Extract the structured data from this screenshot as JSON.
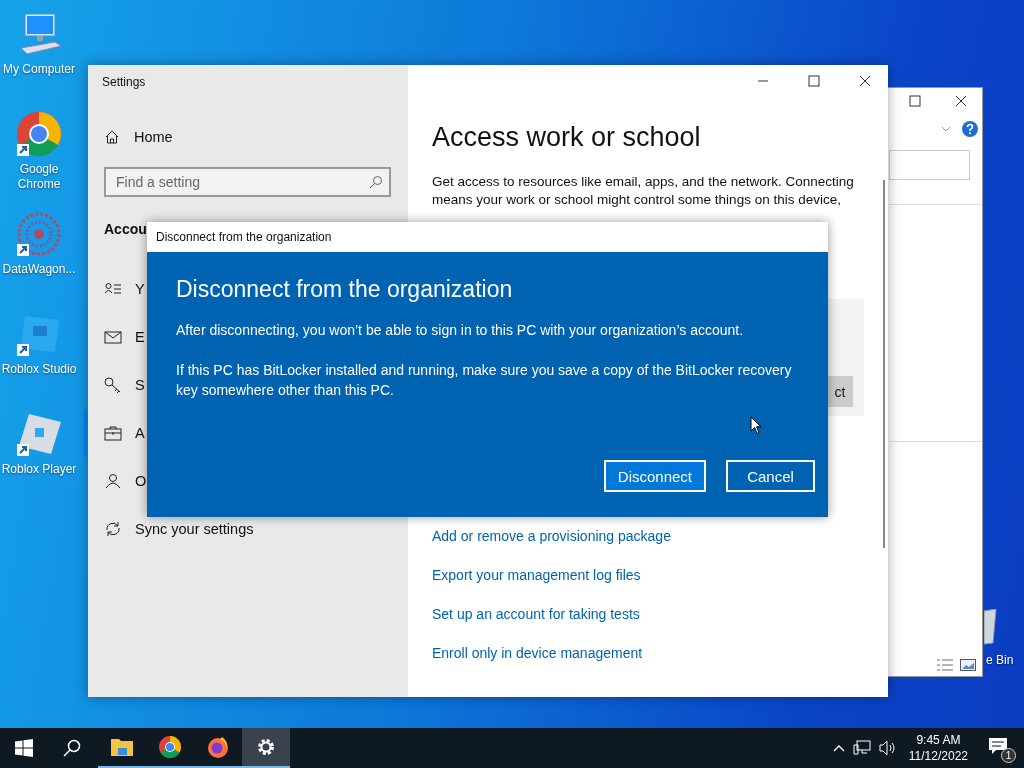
{
  "desktop": {
    "icons": [
      {
        "label": "My Computer",
        "kind": "computer"
      },
      {
        "label": "Google Chrome",
        "kind": "chrome"
      },
      {
        "label": "DataWagon...",
        "kind": "mandala"
      },
      {
        "label": "Roblox Studio",
        "kind": "studio"
      },
      {
        "label": "Roblox Player",
        "kind": "player"
      }
    ],
    "partial_label": "e Bin"
  },
  "settings_window": {
    "title": "Settings",
    "sidebar": {
      "home": "Home",
      "search": {
        "placeholder": "Find a setting"
      },
      "heading": "Accou",
      "items": [
        {
          "label": "Y",
          "kind": "user-info",
          "selected": false
        },
        {
          "label": "E",
          "kind": "mail",
          "selected": false
        },
        {
          "label": "S",
          "kind": "key",
          "selected": false
        },
        {
          "label": "A",
          "kind": "briefcase",
          "selected": true
        },
        {
          "label": "O",
          "kind": "person",
          "selected": false
        },
        {
          "label": "Sync your settings",
          "kind": "sync",
          "selected": false
        }
      ]
    },
    "content": {
      "heading": "Access work or school",
      "description": "Get access to resources like email, apps, and the network. Connecting means your work or school might control some things on this device,",
      "card_button": "ct",
      "links": [
        "Add or remove a provisioning package",
        "Export your management log files",
        "Set up an account for taking tests",
        "Enroll only in device management"
      ]
    }
  },
  "dialog": {
    "title": "Disconnect from the organization",
    "heading": "Disconnect from the organization",
    "paragraphs": [
      "After disconnecting, you won’t be able to sign in to this PC with your organization’s account.",
      "If this PC has BitLocker installed and running, make sure you save a copy of the BitLocker recovery key somewhere other than this PC."
    ],
    "buttons": [
      {
        "label": "Disconnect",
        "focused": true
      },
      {
        "label": "Cancel",
        "focused": false
      }
    ]
  },
  "taskbar": {
    "apps": [
      {
        "kind": "explorer",
        "running": true,
        "active": false
      },
      {
        "kind": "chrome",
        "running": true,
        "active": false
      },
      {
        "kind": "firefox",
        "running": true,
        "active": false
      },
      {
        "kind": "settings",
        "running": true,
        "active": true
      }
    ],
    "time": "9:45 AM",
    "date": "11/12/2022",
    "notification_count": "1"
  }
}
